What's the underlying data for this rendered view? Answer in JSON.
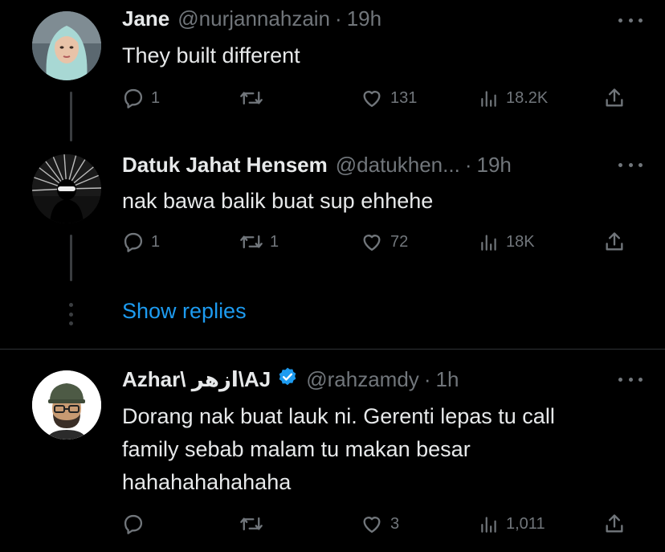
{
  "tweets": [
    {
      "name": "Jane",
      "handle": "@nurjannahzain",
      "time": "19h",
      "text_lines": [
        "They built different"
      ],
      "replies": "1",
      "reposts": "",
      "likes": "131",
      "views": "18.2K"
    },
    {
      "name": "Datuk Jahat Hensem",
      "handle": "@datukhen...",
      "time": "19h",
      "text_lines": [
        "nak bawa balik buat sup ehhehe"
      ],
      "replies": "1",
      "reposts": "1",
      "likes": "72",
      "views": "18K"
    },
    {
      "name_prefix": "Azhar\\ ",
      "name_arabic": "ازهر",
      "name_suffix": "\\AJ",
      "handle": "@rahzamdy",
      "time": "1h",
      "text_lines": [
        "Dorang nak buat lauk ni. Gerenti lepas tu call",
        "family sebab malam tu makan besar",
        "hahahahahahaha"
      ],
      "replies": "",
      "reposts": "",
      "likes": "3",
      "views": "1,011"
    }
  ],
  "show_replies_label": "Show replies",
  "colors": {
    "text": "#e7e9ea",
    "muted": "#71767b",
    "link": "#1d9bf0",
    "verified": "#1d9bf0",
    "divider": "#2f3336"
  },
  "icons": [
    "reply-icon",
    "repost-icon",
    "like-icon",
    "views-icon",
    "share-icon",
    "more-icon",
    "verified-badge-icon"
  ]
}
